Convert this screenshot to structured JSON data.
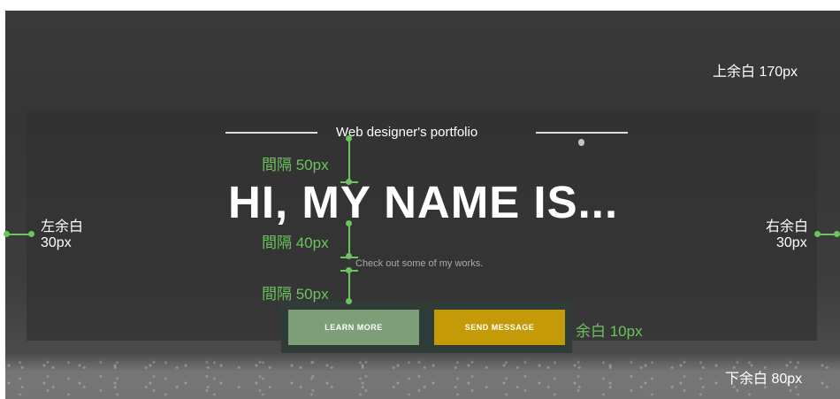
{
  "subtitle": "Web designer's portfolio",
  "hero": "HI, MY NAME IS...",
  "tagline": "Check out some of my works.",
  "buttons": {
    "learn_more": "LEARN MORE",
    "send_message": "SEND MESSAGE"
  },
  "annotations": {
    "top_margin": "上余白 170px",
    "left_margin_1": "左余白",
    "left_margin_2": "30px",
    "right_margin_1": "右余白",
    "right_margin_2": "30px",
    "bottom_margin": "下余白 80px",
    "gap_50_top": "間隔 50px",
    "gap_40": "間隔 40px",
    "gap_50_bottom": "間隔 50px",
    "padding_10": "余白 10px"
  },
  "colors": {
    "annotation_green": "#6cc35f",
    "learn_button": "#7e9e7a",
    "send_button": "#c49a08"
  }
}
